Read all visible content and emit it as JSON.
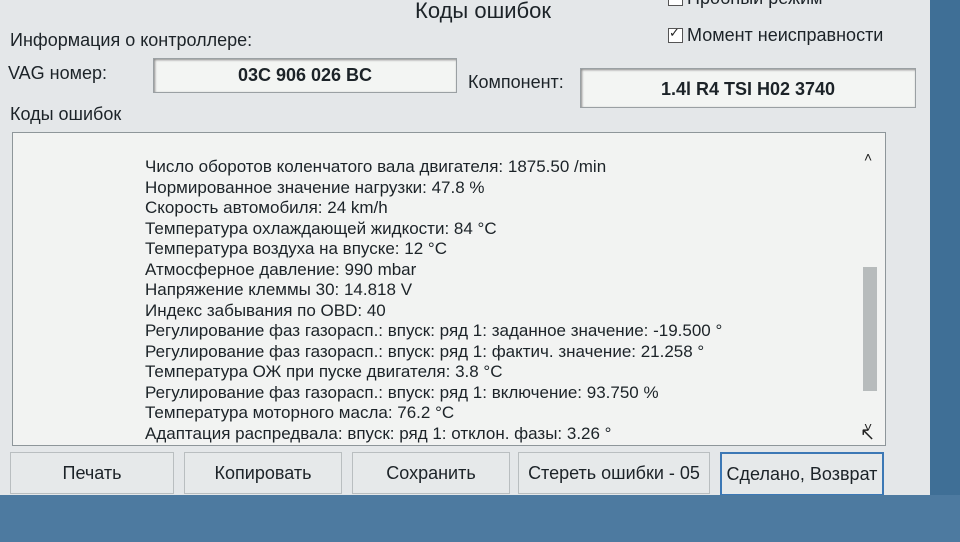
{
  "window": {
    "title": "Коды ошибок"
  },
  "options": {
    "test_mode": {
      "label": "Пробный режим",
      "checked": false
    },
    "freeze_frame": {
      "label": "Момент неисправности",
      "checked": true
    }
  },
  "controller": {
    "section_label": "Информация о контроллере:",
    "vag_label": "VAG номер:",
    "vag_value": "03C 906 026 BC",
    "component_label": "Компонент:",
    "component_value": "1.4l R4 TSI    H02 3740"
  },
  "codes": {
    "section_label": "Коды ошибок",
    "lines": [
      "Число оборотов коленчатого вала двигателя: 1875.50 /min",
      "Нормированное значение нагрузки: 47.8 %",
      "Скорость автомобиля: 24 km/h",
      "Температура охлаждающей жидкости: 84 °C",
      "Температура воздуха на впуске: 12 °C",
      "Атмосферное давление: 990 mbar",
      "Напряжение клеммы 30: 14.818 V",
      "Индекс забывания по OBD: 40",
      "Регулирование фаз газорасп.: впуск: ряд 1: заданное значение: -19.500 °",
      "Регулирование фаз газорасп.: впуск: ряд 1: фактич. значение: 21.258 °",
      "Температура ОЖ при пуске двигателя: 3.8 °C",
      "Регулирование фаз газорасп.: впуск: ряд 1: включение: 93.750 %",
      "Температура моторного масла: 76.2 °C",
      "Адаптация распредвала: впуск: ряд 1: отклон. фазы: 3.26 °"
    ]
  },
  "buttons": {
    "print": "Печать",
    "copy": "Копировать",
    "save": "Сохранить",
    "clear": "Стереть ошибки - 05",
    "done": "Сделано, Возврат"
  },
  "icons": {
    "scroll_up": "chevron-up-icon",
    "scroll_down": "chevron-down-icon",
    "cursor": "mouse-cursor-icon"
  }
}
